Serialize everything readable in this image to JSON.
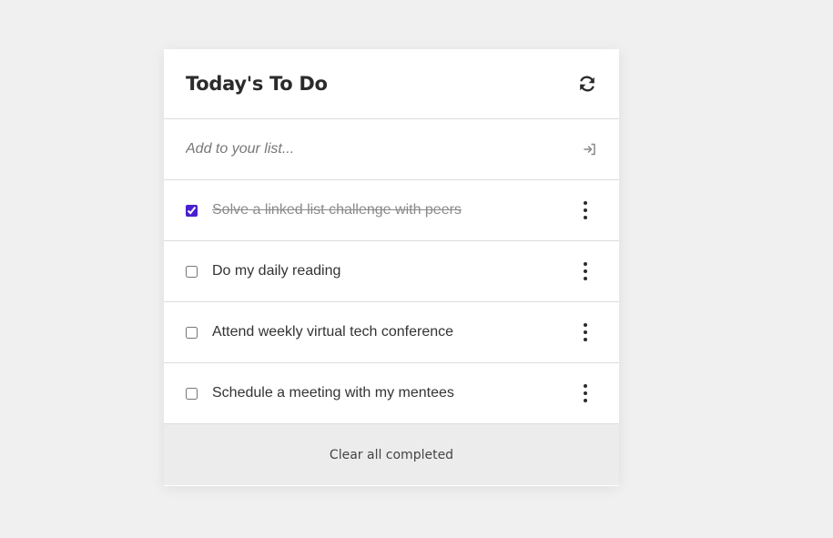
{
  "header": {
    "title": "Today's To Do",
    "refresh_icon": "refresh-icon"
  },
  "add": {
    "placeholder": "Add to your list...",
    "submit_icon": "enter-icon"
  },
  "tasks": [
    {
      "label": "Solve a linked list challenge with peers",
      "completed": true
    },
    {
      "label": "Do my daily reading",
      "completed": false
    },
    {
      "label": "Attend weekly virtual tech conference",
      "completed": false
    },
    {
      "label": "Schedule a meeting with my mentees",
      "completed": false
    }
  ],
  "footer": {
    "clear_label": "Clear all completed"
  },
  "colors": {
    "accent": "#4a1fcf",
    "background": "#f0f0f0",
    "footer_bg": "#ececec"
  }
}
